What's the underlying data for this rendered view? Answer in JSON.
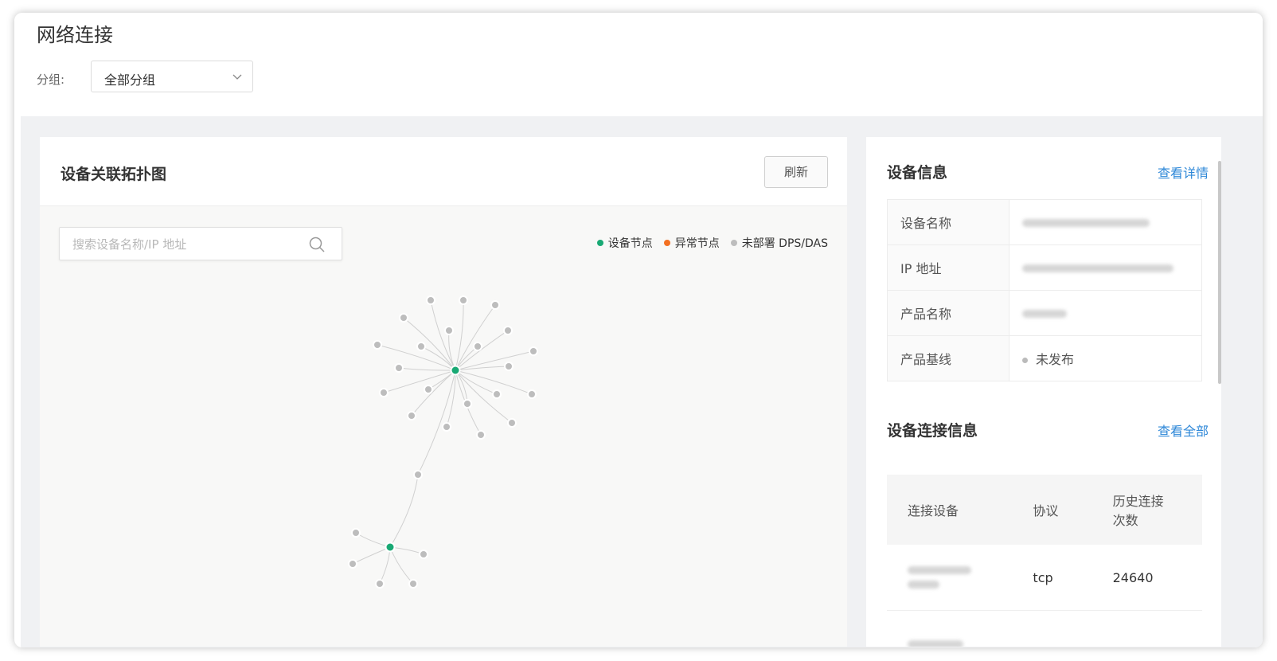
{
  "page": {
    "title": "网络连接"
  },
  "filter": {
    "label": "分组:",
    "selected": "全部分组"
  },
  "topology": {
    "title": "设备关联拓扑图",
    "refresh_label": "刷新",
    "search_placeholder": "搜索设备名称/IP 地址",
    "legend": [
      {
        "label": "设备节点",
        "color": "#19a974"
      },
      {
        "label": "异常节点",
        "color": "#f37021"
      },
      {
        "label": "未部署 DPS/DAS",
        "color": "#bdbdbd"
      }
    ],
    "colors": {
      "device": "#19a974",
      "undeployed": "#bdbdbd",
      "edge": "#d0d0d0"
    }
  },
  "device_info": {
    "title": "设备信息",
    "link": "查看详情",
    "rows": [
      {
        "key": "设备名称"
      },
      {
        "key": "IP 地址"
      },
      {
        "key": "产品名称"
      },
      {
        "key": "产品基线",
        "value": "未发布"
      }
    ]
  },
  "connection_info": {
    "title": "设备连接信息",
    "link": "查看全部",
    "columns": [
      "连接设备",
      "协议",
      "历史连接\n次数"
    ],
    "rows": [
      {
        "protocol": "tcp",
        "count": "24640"
      }
    ]
  }
}
